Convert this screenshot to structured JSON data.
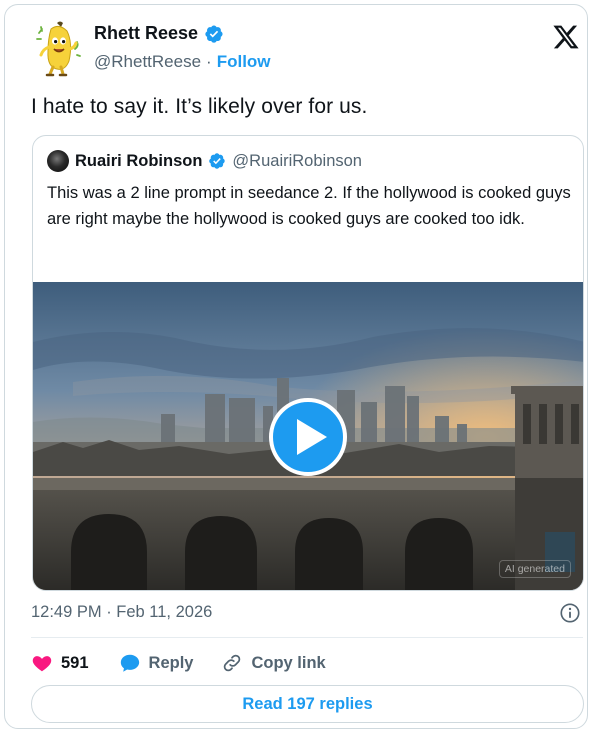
{
  "author": {
    "display_name": "Rhett Reese",
    "handle": "@RhettReese",
    "separator": "·",
    "follow_label": "Follow",
    "avatar_icon": "banana-avatar-icon",
    "verified_icon": "verified-badge-icon"
  },
  "tweet": {
    "text": "I hate to say it. It’s likely over for us."
  },
  "quote": {
    "display_name": "Ruairi Robinson",
    "handle": "@RuairiRobinson",
    "text": "This was a 2 line prompt in seedance 2. If the hollywood is cooked guys are right maybe the hollywood is cooked guys are cooked too idk.",
    "media_label": "AI generated",
    "media_icon": "play-icon"
  },
  "footer": {
    "timestamp": "12:49 PM · Feb 11, 2026",
    "like_count": "591",
    "reply_label": "Reply",
    "copy_link_label": "Copy link",
    "read_replies_label": "Read 197 replies"
  },
  "colors": {
    "accent": "#1d9bf0",
    "like": "#f91880",
    "text": "#0f1419",
    "secondary": "#536471",
    "border": "#cfd9de"
  }
}
